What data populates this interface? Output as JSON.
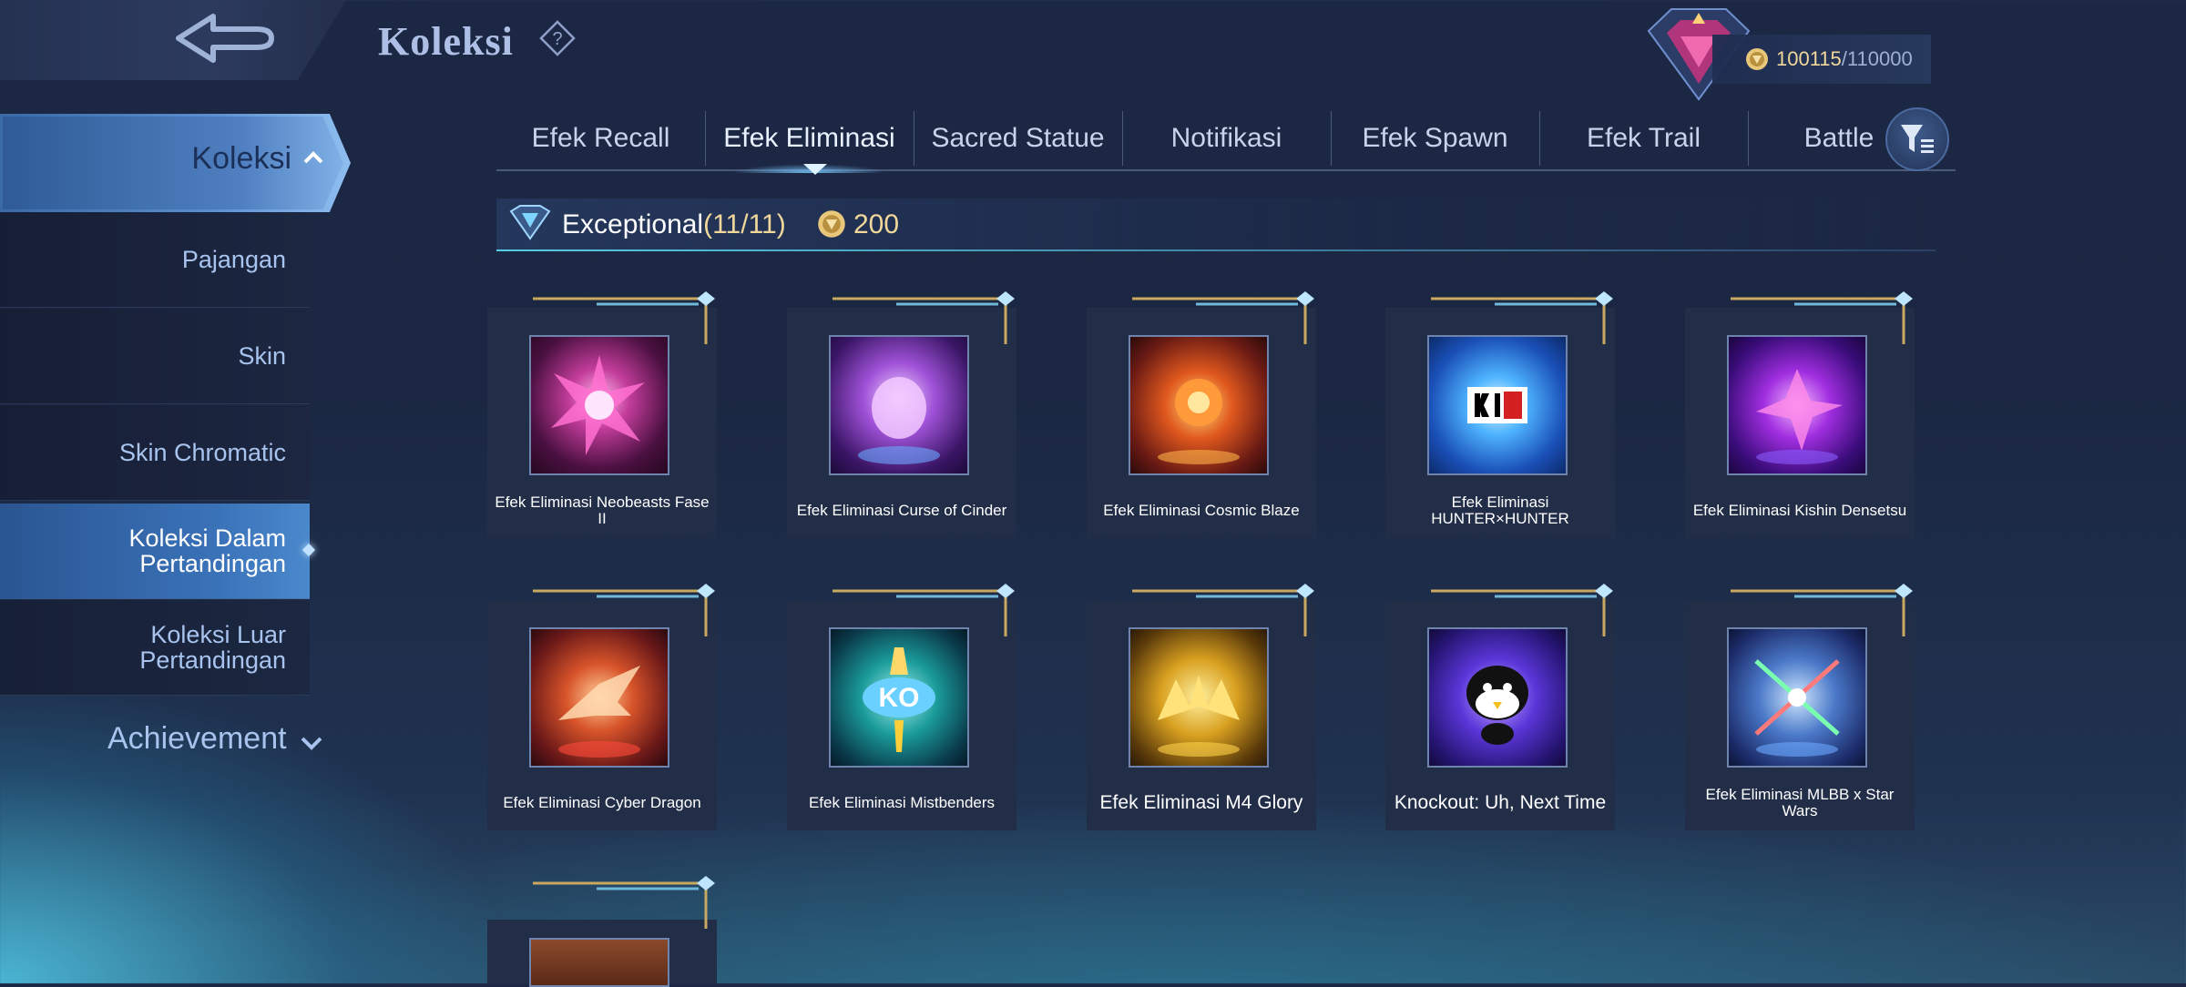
{
  "header": {
    "title": "Koleksi",
    "points": "100115",
    "points_max": "/110000"
  },
  "sidebar": {
    "main": "Koleksi",
    "items": [
      {
        "label": "Pajangan"
      },
      {
        "label": "Skin"
      },
      {
        "label": "Skin Chromatic"
      },
      {
        "label": "Koleksi Dalam Pertandingan"
      },
      {
        "label": "Koleksi Luar Pertandingan"
      }
    ],
    "achievement": "Achievement"
  },
  "tabs": [
    "Efek Recall",
    "Efek Eliminasi",
    "Sacred Statue",
    "Notifikasi",
    "Efek Spawn",
    "Efek Trail",
    "Battle"
  ],
  "section": {
    "title": "Exceptional",
    "count": "(11/11)",
    "value": "200"
  },
  "items": [
    {
      "name": "Efek Eliminasi Neobeasts Fase II"
    },
    {
      "name": "Efek Eliminasi Curse of Cinder"
    },
    {
      "name": "Efek Eliminasi Cosmic Blaze"
    },
    {
      "name": "Efek Eliminasi HUNTER×HUNTER"
    },
    {
      "name": "Efek Eliminasi Kishin Densetsu"
    },
    {
      "name": "Efek Eliminasi Cyber Dragon"
    },
    {
      "name": "Efek Eliminasi Mistbenders"
    },
    {
      "name": "Efek Eliminasi M4 Glory"
    },
    {
      "name": "Knockout: Uh, Next Time"
    },
    {
      "name": "Efek Eliminasi MLBB x Star Wars"
    }
  ],
  "colors": {
    "accent": "#7fb0e6",
    "gold": "#f1d89a"
  }
}
